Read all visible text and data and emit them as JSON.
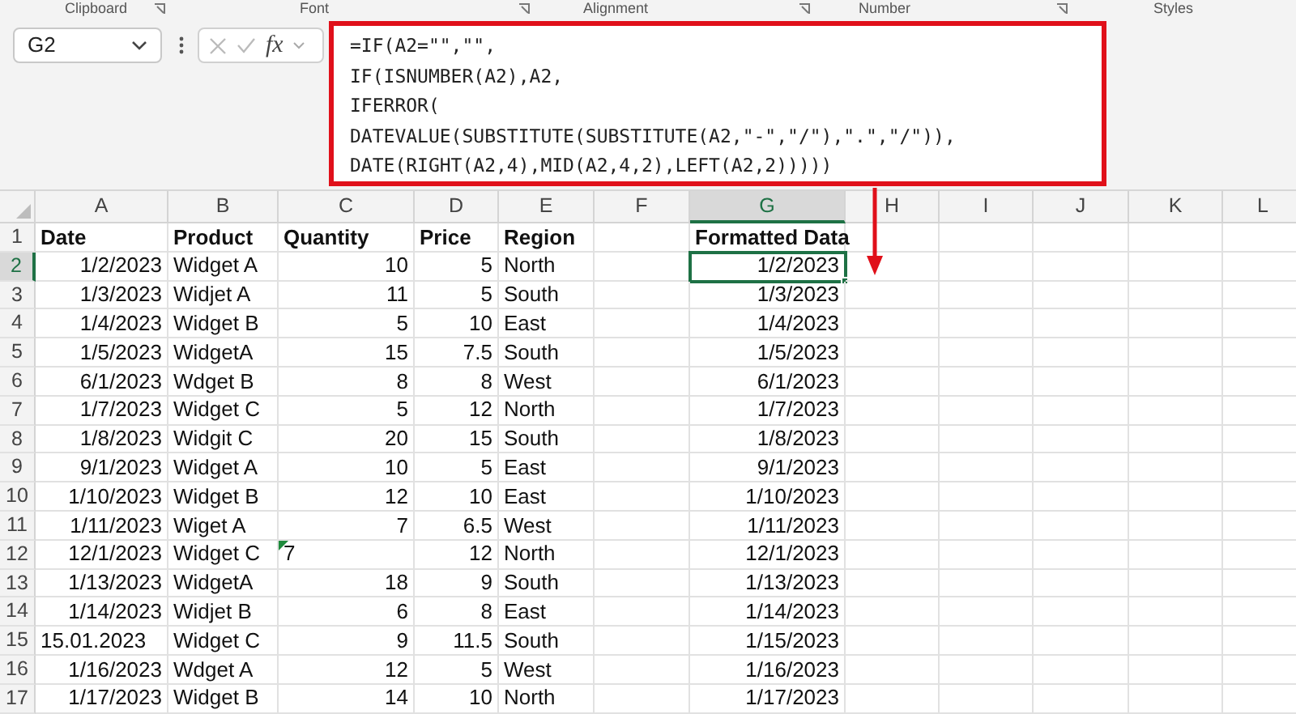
{
  "ribbon_groups": [
    "Clipboard",
    "Font",
    "Alignment",
    "Number",
    "Styles"
  ],
  "name_box": {
    "value": "G2"
  },
  "formula_bar": {
    "fx": "fx",
    "lines": [
      "=IF(A2=\"\",\"\",",
      "IF(ISNUMBER(A2),A2,",
      "IFERROR(",
      "DATEVALUE(SUBSTITUTE(SUBSTITUTE(A2,\"-\",\"/\"),\".\",\"/\")),",
      "DATE(RIGHT(A2,4),MID(A2,4,2),LEFT(A2,2)))))"
    ]
  },
  "columns": [
    {
      "label": "A",
      "selected": false
    },
    {
      "label": "B",
      "selected": false
    },
    {
      "label": "C",
      "selected": false
    },
    {
      "label": "D",
      "selected": false
    },
    {
      "label": "E",
      "selected": false
    },
    {
      "label": "F",
      "selected": false
    },
    {
      "label": "G",
      "selected": true
    },
    {
      "label": "H",
      "selected": false
    },
    {
      "label": "I",
      "selected": false
    },
    {
      "label": "J",
      "selected": false
    },
    {
      "label": "K",
      "selected": false
    },
    {
      "label": "L",
      "selected": false
    }
  ],
  "rows": [
    {
      "number": "1",
      "kind": "header",
      "selected": false,
      "cells": [
        "Date",
        "Product",
        "Quantity",
        "Price",
        "Region",
        "",
        "Formatted Data"
      ]
    },
    {
      "number": "2",
      "kind": "data",
      "selected": true,
      "cells": [
        "1/2/2023",
        "Widget A",
        "10",
        "5",
        "North",
        "",
        "1/2/2023"
      ]
    },
    {
      "number": "3",
      "kind": "data",
      "selected": false,
      "cells": [
        "1/3/2023",
        "Widjet A",
        "11",
        "5",
        "South",
        "",
        "1/3/2023"
      ]
    },
    {
      "number": "4",
      "kind": "data",
      "selected": false,
      "cells": [
        "1/4/2023",
        "Widget B",
        "5",
        "10",
        "East",
        "",
        "1/4/2023"
      ]
    },
    {
      "number": "5",
      "kind": "data",
      "selected": false,
      "cells": [
        "1/5/2023",
        "WidgetA",
        "15",
        "7.5",
        "South",
        "",
        "1/5/2023"
      ]
    },
    {
      "number": "6",
      "kind": "data",
      "selected": false,
      "cells": [
        "6/1/2023",
        "Wdget B",
        "8",
        "8",
        "West",
        "",
        "6/1/2023"
      ]
    },
    {
      "number": "7",
      "kind": "data",
      "selected": false,
      "cells": [
        "1/7/2023",
        "Widget C",
        "5",
        "12",
        "North",
        "",
        "1/7/2023"
      ]
    },
    {
      "number": "8",
      "kind": "data",
      "selected": false,
      "cells": [
        "1/8/2023",
        "Widgit C",
        "20",
        "15",
        "South",
        "",
        "1/8/2023"
      ]
    },
    {
      "number": "9",
      "kind": "data",
      "selected": false,
      "cells": [
        "9/1/2023",
        "Widget A",
        "10",
        "5",
        "East",
        "",
        "9/1/2023"
      ]
    },
    {
      "number": "10",
      "kind": "data",
      "selected": false,
      "cells": [
        "1/10/2023",
        "Widget B",
        "12",
        "10",
        "East",
        "",
        "1/10/2023"
      ]
    },
    {
      "number": "11",
      "kind": "data",
      "selected": false,
      "cells": [
        "1/11/2023",
        "Wiget A",
        "7",
        "6.5",
        "West",
        "",
        "1/11/2023"
      ]
    },
    {
      "number": "12",
      "kind": "quantity_as_text",
      "selected": false,
      "cells": [
        "12/1/2023",
        "Widget C",
        "7",
        "12",
        "North",
        "",
        "12/1/2023"
      ]
    },
    {
      "number": "13",
      "kind": "data",
      "selected": false,
      "cells": [
        "1/13/2023",
        "WidgetA",
        "18",
        "9",
        "South",
        "",
        "1/13/2023"
      ]
    },
    {
      "number": "14",
      "kind": "data",
      "selected": false,
      "cells": [
        "1/14/2023",
        "Widjet B",
        "6",
        "8",
        "East",
        "",
        "1/14/2023"
      ]
    },
    {
      "number": "15",
      "kind": "date_as_text",
      "selected": false,
      "cells": [
        "15.01.2023",
        "Widget C",
        "9",
        "11.5",
        "South",
        "",
        "1/15/2023"
      ]
    },
    {
      "number": "16",
      "kind": "data",
      "selected": false,
      "cells": [
        "1/16/2023",
        "Wdget A",
        "12",
        "5",
        "West",
        "",
        "1/16/2023"
      ]
    },
    {
      "number": "17",
      "kind": "data",
      "selected": false,
      "cells": [
        "1/17/2023",
        "Widget B",
        "14",
        "10",
        "North",
        "",
        "1/17/2023"
      ]
    }
  ]
}
